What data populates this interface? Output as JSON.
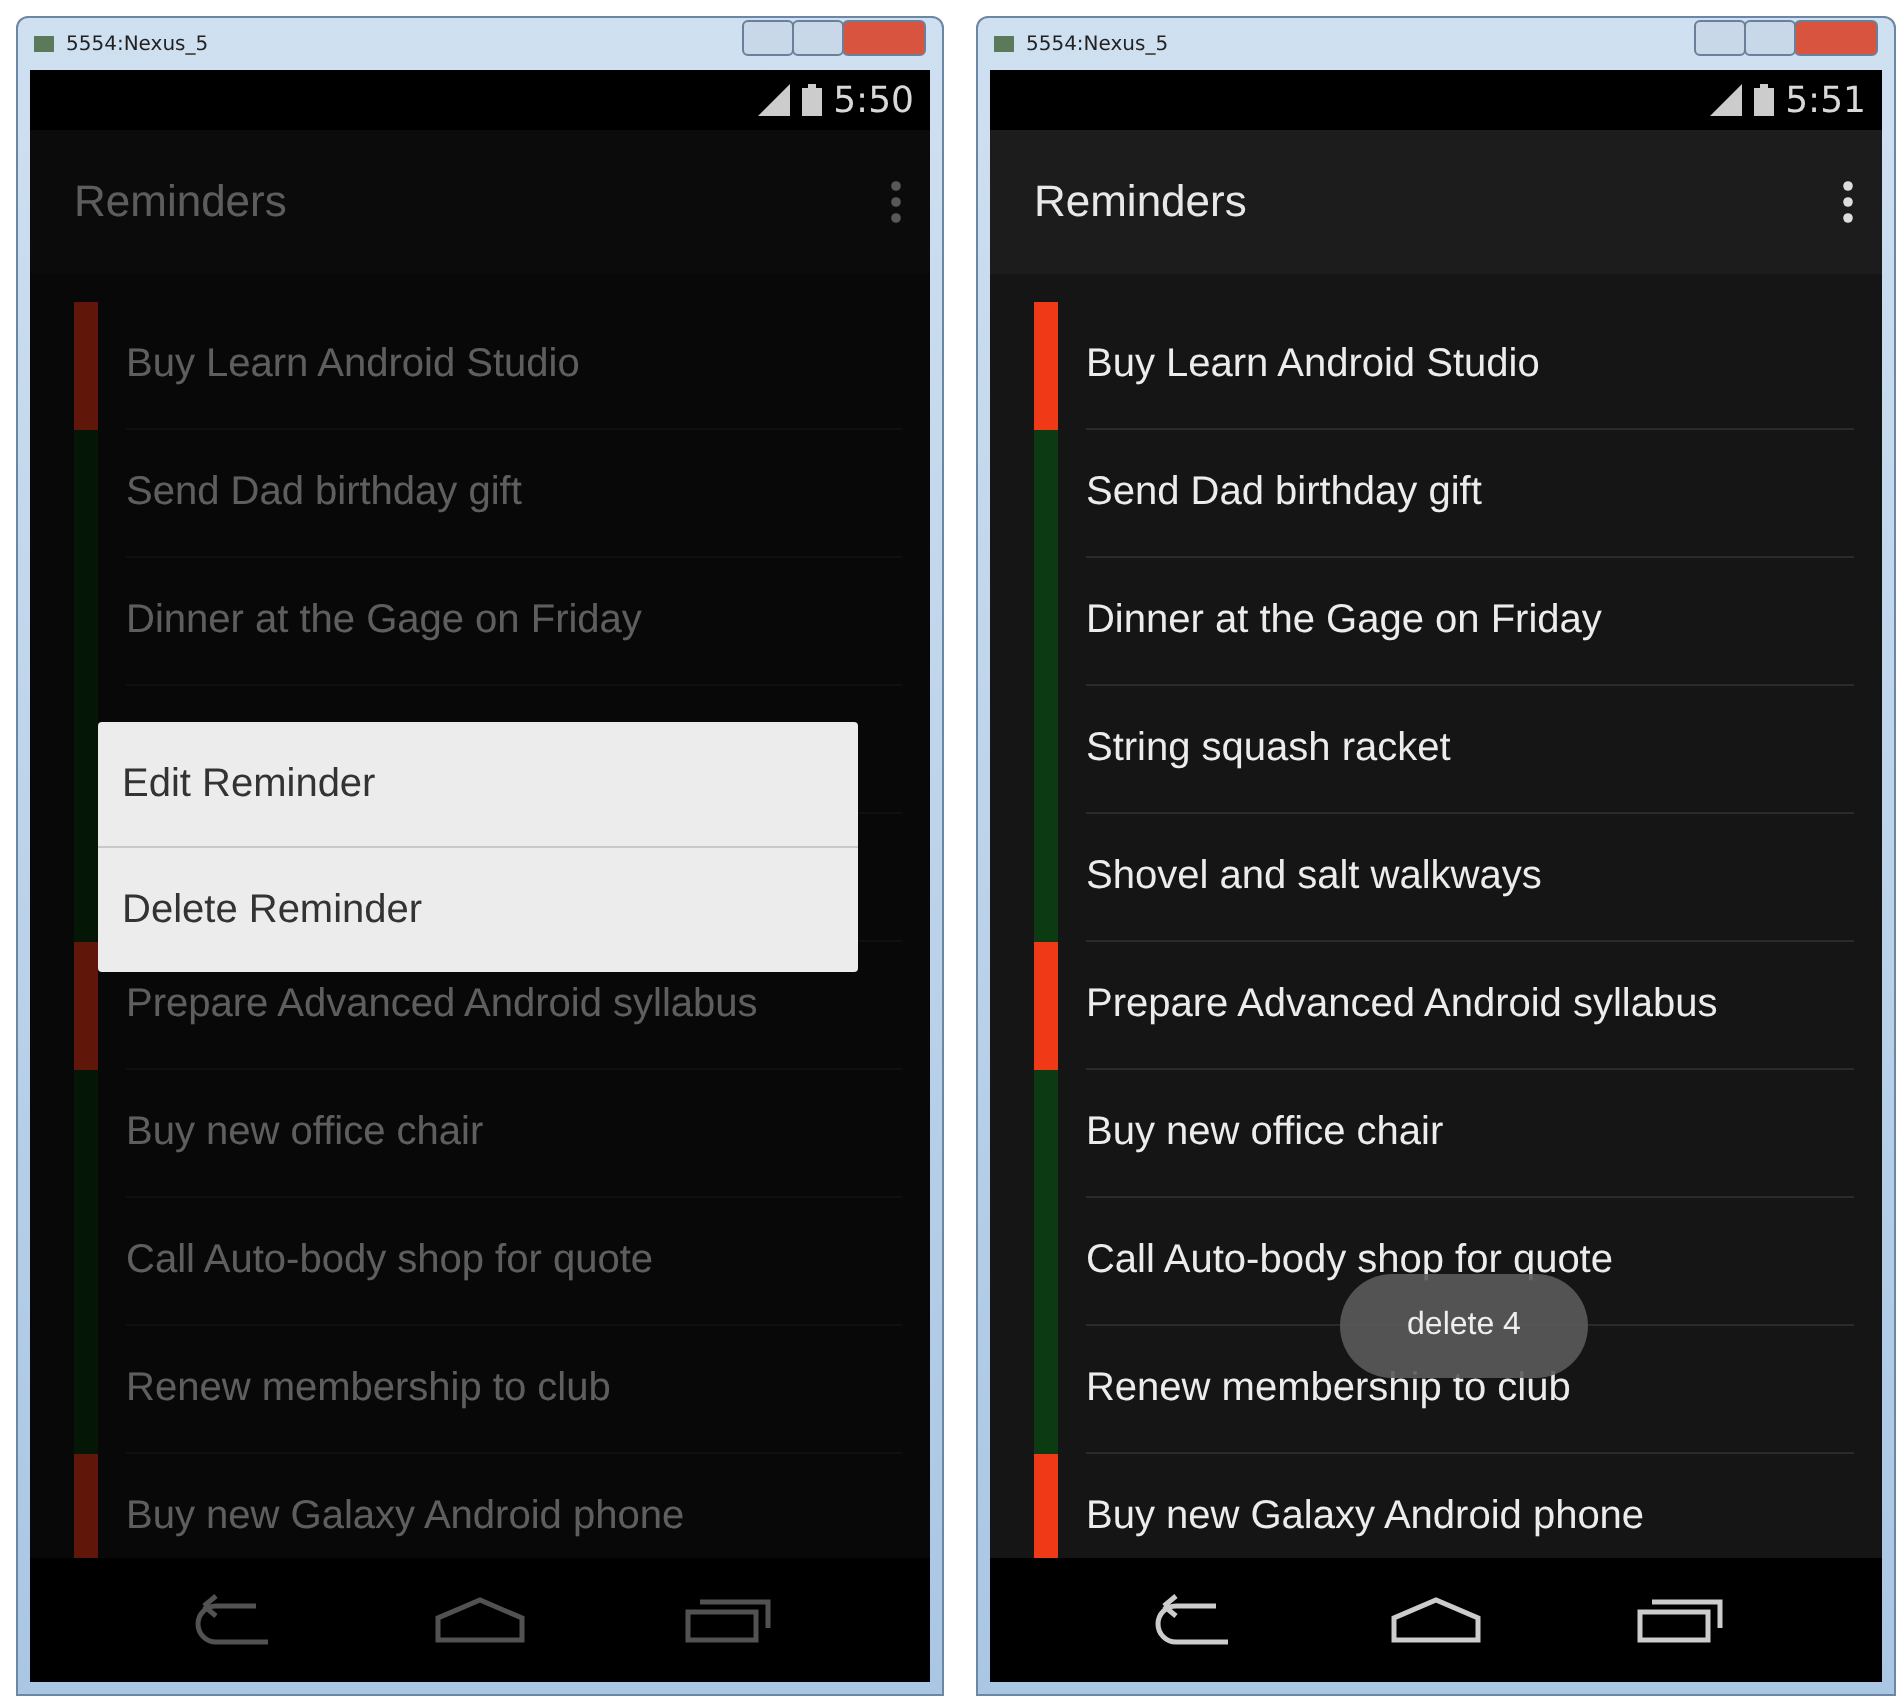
{
  "windows": [
    {
      "title": "5554:Nexus_5",
      "status_time": "5:50",
      "app_title": "Reminders",
      "dimmed": true,
      "reminders": [
        {
          "text": "Buy Learn Android Studio",
          "important": true
        },
        {
          "text": "Send Dad birthday gift",
          "important": false
        },
        {
          "text": "Dinner at the Gage on Friday",
          "important": false
        },
        {
          "important": false
        },
        {
          "important": false
        },
        {
          "text": "Prepare Advanced Android syllabus",
          "important": true
        },
        {
          "text": "Buy new office chair",
          "important": false
        },
        {
          "text": "Call Auto-body shop for quote",
          "important": false
        },
        {
          "text": "Renew membership to club",
          "important": false
        },
        {
          "text": "Buy new Galaxy Android phone",
          "important": true
        }
      ],
      "context_menu": [
        "Edit Reminder",
        "Delete Reminder"
      ]
    },
    {
      "title": "5554:Nexus_5",
      "status_time": "5:51",
      "app_title": "Reminders",
      "dimmed": false,
      "reminders": [
        {
          "text": "Buy Learn Android Studio",
          "important": true
        },
        {
          "text": "Send Dad birthday gift",
          "important": false
        },
        {
          "text": "Dinner at the Gage on Friday",
          "important": false
        },
        {
          "text": "String squash racket",
          "important": false
        },
        {
          "text": "Shovel and salt walkways",
          "important": false
        },
        {
          "text": "Prepare Advanced Android syllabus",
          "important": true
        },
        {
          "text": "Buy new office chair",
          "important": false
        },
        {
          "text": "Call Auto-body shop for quote",
          "important": false
        },
        {
          "text": "Renew membership to club",
          "important": false
        },
        {
          "text": "Buy new Galaxy Android phone",
          "important": true
        }
      ],
      "toast": "delete 4"
    }
  ]
}
